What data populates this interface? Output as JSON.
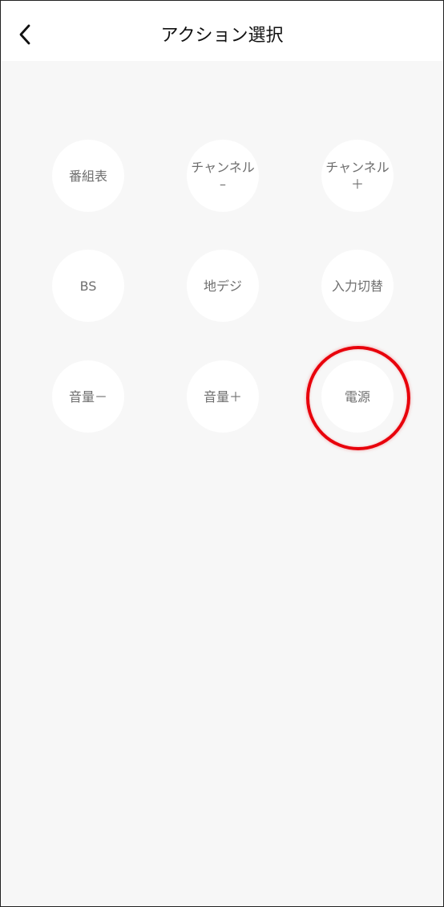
{
  "header": {
    "title": "アクション選択",
    "back_icon": "chevron-left-icon"
  },
  "actions": [
    {
      "line1": "番組表",
      "line2": ""
    },
    {
      "line1": "チャンネル",
      "line2": "–"
    },
    {
      "line1": "チャンネル",
      "line2": "＋"
    },
    {
      "line1": "BS",
      "line2": ""
    },
    {
      "line1": "地デジ",
      "line2": ""
    },
    {
      "line1": "入力切替",
      "line2": ""
    },
    {
      "line1": "音量－",
      "line2": ""
    },
    {
      "line1": "音量＋",
      "line2": ""
    },
    {
      "line1": "電源",
      "line2": ""
    }
  ],
  "highlight": {
    "target": "電源",
    "color": "#e8000b"
  },
  "colors": {
    "background": "#f7f7f7",
    "header": "#ffffff",
    "button": "#ffffff",
    "label": "#6f6f6f"
  }
}
